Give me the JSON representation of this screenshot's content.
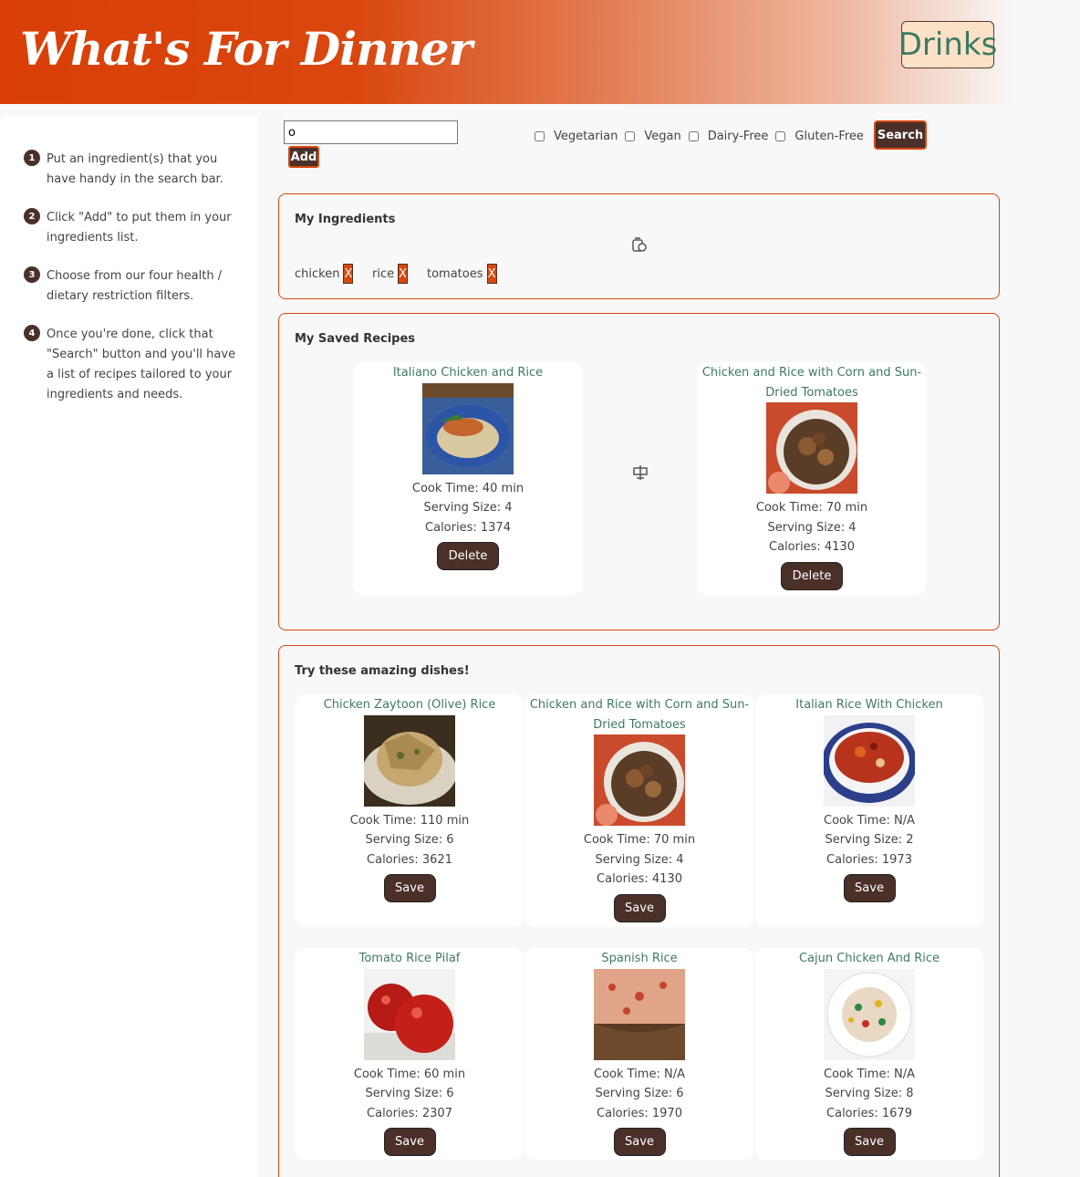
{
  "header": {
    "title": "What's For Dinner",
    "drinks_label": "Drinks"
  },
  "sidebar": {
    "steps": [
      {
        "num": "1",
        "text": "Put an ingredient(s) that you have handy in the search bar."
      },
      {
        "num": "2",
        "text": "Click \"Add\" to put them in your ingredients list."
      },
      {
        "num": "3",
        "text": "Choose from our four health / dietary restriction filters."
      },
      {
        "num": "4",
        "text": "Once you're done, click that \"Search\" button and you'll have a list of recipes tailored to your ingredients and needs."
      }
    ]
  },
  "search": {
    "value": "o",
    "add_label": "Add",
    "search_label": "Search"
  },
  "filters": [
    "Vegetarian",
    "Vegan",
    "Dairy-Free",
    "Gluten-Free"
  ],
  "ingredients": {
    "title": "My Ingredients",
    "items": [
      {
        "name": "chicken",
        "remove": "X"
      },
      {
        "name": "rice",
        "remove": "X"
      },
      {
        "name": "tomatoes",
        "remove": "X"
      }
    ]
  },
  "saved": {
    "title": "My Saved Recipes",
    "recipes": [
      {
        "title": "Italiano Chicken and Rice",
        "cook": "Cook Time: 40 min",
        "serving": "Serving Size: 4",
        "calories": "Calories: 1374",
        "button": "Delete"
      },
      {
        "title": "Chicken and Rice with Corn and Sun-Dried Tomatoes",
        "cook": "Cook Time: 70 min",
        "serving": "Serving Size: 4",
        "calories": "Calories: 4130",
        "button": "Delete"
      }
    ]
  },
  "dishes": {
    "title": "Try these amazing dishes!",
    "recipes": [
      {
        "title": "Chicken Zaytoon (Olive) Rice",
        "cook": "Cook Time: 110 min",
        "serving": "Serving Size: 6",
        "calories": "Calories: 3621",
        "button": "Save"
      },
      {
        "title": "Chicken and Rice with Corn and Sun-Dried Tomatoes",
        "cook": "Cook Time: 70 min",
        "serving": "Serving Size: 4",
        "calories": "Calories: 4130",
        "button": "Save"
      },
      {
        "title": "Italian Rice With Chicken",
        "cook": "Cook Time: N/A",
        "serving": "Serving Size: 2",
        "calories": "Calories: 1973",
        "button": "Save"
      },
      {
        "title": "Tomato Rice Pilaf",
        "cook": "Cook Time: 60 min",
        "serving": "Serving Size: 6",
        "calories": "Calories: 2307",
        "button": "Save"
      },
      {
        "title": "Spanish Rice",
        "cook": "Cook Time: N/A",
        "serving": "Serving Size: 6",
        "calories": "Calories: 1970",
        "button": "Save"
      },
      {
        "title": "Cajun Chicken And Rice",
        "cook": "Cook Time: N/A",
        "serving": "Serving Size: 8",
        "calories": "Calories: 1679",
        "button": "Save"
      }
    ]
  }
}
